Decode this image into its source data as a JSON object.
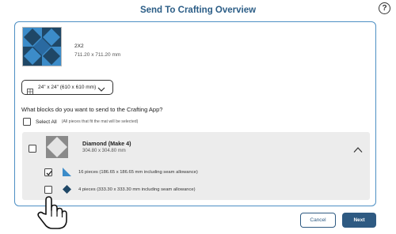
{
  "dialog": {
    "title": "Send To Crafting Overview",
    "help_glyph": "?"
  },
  "design": {
    "name": "2X2",
    "dimensions": "711.20 x 711.20 mm"
  },
  "mat_select": {
    "value": "24\" x 24\" (610 x 610 mm)"
  },
  "question": "What blocks do you want to send to the Crafting App?",
  "select_all": {
    "label": "Select All",
    "note": "(All pieces that fit the mat will be selected)",
    "checked": false
  },
  "blocks": [
    {
      "name": "Diamond (Make 4)",
      "dimensions": "304.80 x 304.80 mm",
      "checked": false,
      "expanded": true,
      "pieces": [
        {
          "label": "16 pieces (186.65 x 186.65 mm including seam allowance)",
          "checked": true,
          "icon": "triangle-piece-icon"
        },
        {
          "label": "4 pieces (333.30 x 333.30 mm including seam allowance)",
          "checked": false,
          "icon": "diamond-piece-icon"
        }
      ]
    }
  ],
  "buttons": {
    "cancel": "Cancel",
    "next": "Next"
  },
  "colors": {
    "accent": "#2e5a82",
    "title": "#2b5d86",
    "panel_border": "#4d8fc4",
    "quilt_dark": "#1f4766",
    "quilt_light": "#3c8cc9",
    "card_bg": "#ececec"
  }
}
